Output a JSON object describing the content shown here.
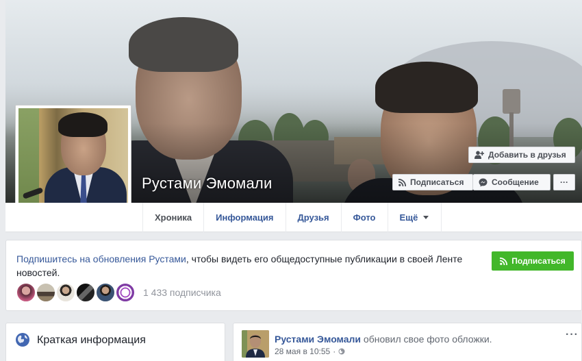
{
  "profile": {
    "name": "Рустами Эмомали"
  },
  "cover_actions": {
    "add_friend": "Добавить в друзья",
    "subscribe": "Подписаться",
    "message": "Сообщение",
    "more": "···"
  },
  "nav": {
    "tabs": [
      {
        "label": "Хроника"
      },
      {
        "label": "Информация"
      },
      {
        "label": "Друзья"
      },
      {
        "label": "Фото"
      },
      {
        "label": "Ещё"
      }
    ]
  },
  "subscribe_panel": {
    "link_text": "Подпишитесь на обновления Рустами",
    "text": ", чтобы видеть его общедоступные публикации в своей Ленте новостей.",
    "button": "Подписаться",
    "follower_count": "1 433 подписчика"
  },
  "info_panel": {
    "title": "Краткая информация"
  },
  "post": {
    "author": "Рустами Эмомали",
    "action": "обновил свое фото обложки.",
    "time": "28 мая в 10:55",
    "dot": "·",
    "more": "···"
  },
  "colors": {
    "link": "#365899",
    "green": "#42b72a",
    "background": "#e9ebee"
  }
}
